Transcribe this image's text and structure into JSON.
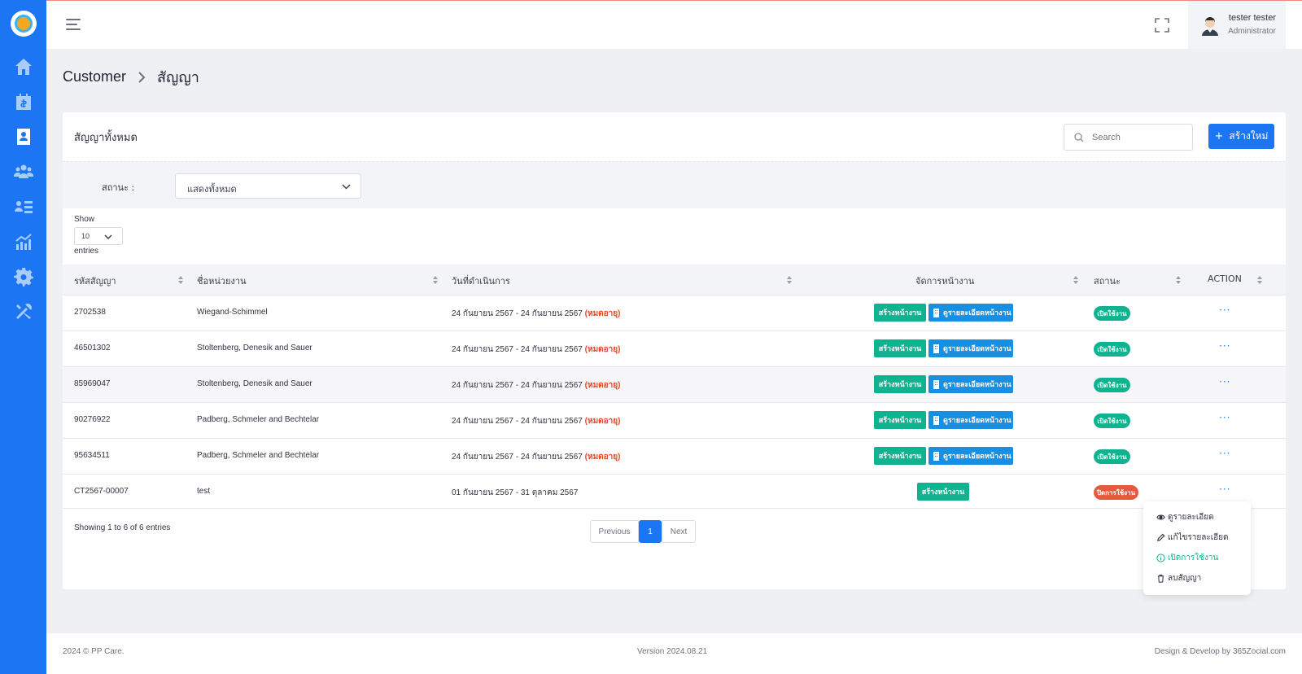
{
  "header": {
    "user_name": "tester tester",
    "user_role": "Administrator"
  },
  "sidebar": {
    "items": [
      {
        "icon": "home-icon"
      },
      {
        "icon": "calendar-dollar-icon"
      },
      {
        "icon": "contact-book-icon",
        "active": true
      },
      {
        "icon": "group-users-icon"
      },
      {
        "icon": "user-list-icon"
      },
      {
        "icon": "chart-growth-icon"
      },
      {
        "icon": "gear-icon"
      },
      {
        "icon": "tools-icon"
      }
    ]
  },
  "breadcrumb": {
    "parent": "Customer",
    "current": "สัญญา"
  },
  "card": {
    "title": "สัญญาทั้งหมด",
    "search_placeholder": "Search",
    "create_label": "สร้างใหม่",
    "filter_label": "สถานะ :",
    "filter_value": "แสดงทั้งหมด",
    "show_label": "Show",
    "page_size": "10",
    "entries_label": "entries"
  },
  "table": {
    "columns": [
      "รหัสสัญญา",
      "ชื่อหน่วยงาน",
      "วันที่ดำเนินการ",
      "จัดการหน้างาน",
      "สถานะ",
      "ACTION"
    ],
    "create_page_label": "สร้างหน้างาน",
    "view_page_label": "ดูรายละเอียดหน้างาน",
    "expired_label": "(หมดอายุ)",
    "rows": [
      {
        "code": "2702538",
        "agency": "Wiegand-Schimmel",
        "dates": "24 กันยายน 2567 - 24 กันยายน 2567",
        "expired": true,
        "status": "เปิดใช้งาน",
        "active": true
      },
      {
        "code": "46501302",
        "agency": "Stoltenberg, Denesik and Sauer",
        "dates": "24 กันยายน 2567 - 24 กันยายน 2567",
        "expired": true,
        "status": "เปิดใช้งาน",
        "active": true
      },
      {
        "code": "85969047",
        "agency": "Stoltenberg, Denesik and Sauer",
        "dates": "24 กันยายน 2567 - 24 กันยายน 2567",
        "expired": true,
        "status": "เปิดใช้งาน",
        "active": true
      },
      {
        "code": "90276922",
        "agency": "Padberg, Schmeler and Bechtelar",
        "dates": "24 กันยายน 2567 - 24 กันยายน 2567",
        "expired": true,
        "status": "เปิดใช้งาน",
        "active": true
      },
      {
        "code": "95634511",
        "agency": "Padberg, Schmeler and Bechtelar",
        "dates": "24 กันยายน 2567 - 24 กันยายน 2567",
        "expired": true,
        "status": "เปิดใช้งาน",
        "active": true
      },
      {
        "code": "CT2567-00007",
        "agency": "test",
        "dates": "01 กันยายน 2567 - 31 ตุลาคม 2567",
        "expired": false,
        "status": "ปิดการใช้งาน",
        "active": false
      }
    ],
    "dots": "···"
  },
  "pagination": {
    "info": "Showing 1 to 6 of 6 entries",
    "previous": "Previous",
    "current": "1",
    "next": "Next"
  },
  "menu": {
    "view": "ดูรายละเอียด",
    "edit": "แก้ไขรายละเอียด",
    "enable": "เปิดการใช้งาน",
    "delete": "ลบสัญญา"
  },
  "footer": {
    "copyright": "2024 © PP Care.",
    "version": "Version 2024.08.21",
    "credit": "Design & Develop by 365Zocial.com"
  },
  "colors": {
    "primary": "#1c75f2",
    "green": "#10b38f",
    "info": "#1a8fe0",
    "danger": "#e8482c"
  }
}
